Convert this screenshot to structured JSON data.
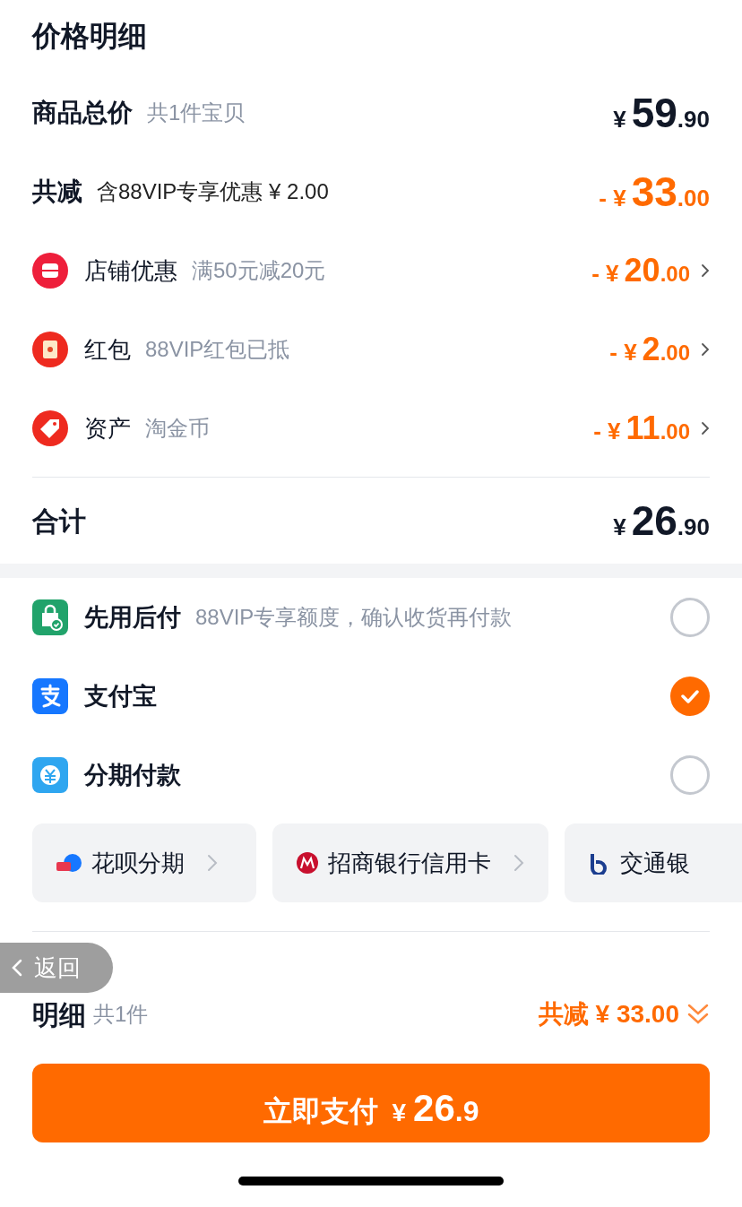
{
  "title": "价格明细",
  "summary": [
    {
      "label": "商品总价",
      "note": "共1件宝贝",
      "amount": {
        "currency": "¥",
        "whole": "59",
        "fraction": ".90"
      }
    },
    {
      "label": "共减",
      "note": "含88VIP专享优惠 ¥ 2.00",
      "amount": {
        "sign": "-",
        "currency": "¥",
        "whole": "33",
        "fraction": ".00"
      }
    }
  ],
  "discounts": [
    {
      "kind": "store",
      "label": "店铺优惠",
      "note": "满50元减20元",
      "amount": {
        "sign": "-",
        "currency": "¥",
        "whole": "20",
        "fraction": ".00"
      }
    },
    {
      "kind": "redpacket",
      "label": "红包",
      "note": "88VIP红包已抵",
      "amount": {
        "sign": "-",
        "currency": "¥",
        "whole": "2",
        "fraction": ".00"
      }
    },
    {
      "kind": "coin",
      "label": "资产",
      "note": "淘金币",
      "amount": {
        "sign": "-",
        "currency": "¥",
        "whole": "11",
        "fraction": ".00"
      }
    }
  ],
  "total": {
    "label": "合计",
    "amount": {
      "currency": "¥",
      "whole": "26",
      "fraction": ".90"
    }
  },
  "payment_methods": [
    {
      "kind": "paylater",
      "label": "先用后付",
      "note": "88VIP专享额度，确认收货再付款",
      "selected": false
    },
    {
      "kind": "alipay",
      "label": "支付宝",
      "selected": true
    },
    {
      "kind": "installment",
      "label": "分期付款",
      "selected": false
    }
  ],
  "installment_options": [
    {
      "kind": "huabei",
      "label": "花呗分期"
    },
    {
      "kind": "cmb",
      "label": "招商银行信用卡"
    },
    {
      "kind": "bocom",
      "label": "交通银"
    }
  ],
  "back_button": {
    "label": "返回"
  },
  "footer": {
    "label": "明细",
    "note": "共1件",
    "discount": "共减 ¥ 33.00",
    "pay_button": {
      "label": "立即支付",
      "currency": "¥",
      "whole": "26",
      "fraction": ".9"
    }
  }
}
